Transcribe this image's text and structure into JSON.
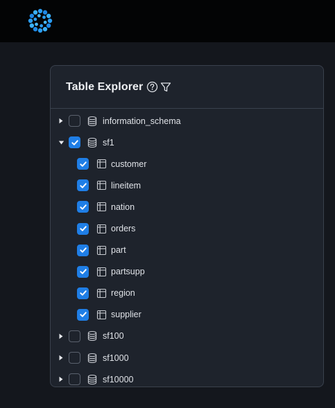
{
  "app": {
    "logo_icon": "dotted-circle-logo-icon",
    "accent_color": "#1f7ee6"
  },
  "explorer": {
    "title": "Table Explorer",
    "help_icon": "question-circle-icon",
    "filter_icon": "filter-funnel-icon",
    "schemas": [
      {
        "name": "information_schema",
        "expanded": false,
        "checked": false,
        "tables": []
      },
      {
        "name": "sf1",
        "expanded": true,
        "checked": true,
        "tables": [
          {
            "name": "customer",
            "checked": true
          },
          {
            "name": "lineitem",
            "checked": true
          },
          {
            "name": "nation",
            "checked": true
          },
          {
            "name": "orders",
            "checked": true
          },
          {
            "name": "part",
            "checked": true
          },
          {
            "name": "partsupp",
            "checked": true
          },
          {
            "name": "region",
            "checked": true
          },
          {
            "name": "supplier",
            "checked": true
          }
        ]
      },
      {
        "name": "sf100",
        "expanded": false,
        "checked": false,
        "tables": []
      },
      {
        "name": "sf1000",
        "expanded": false,
        "checked": false,
        "tables": []
      },
      {
        "name": "sf10000",
        "expanded": false,
        "checked": false,
        "tables": []
      }
    ]
  }
}
